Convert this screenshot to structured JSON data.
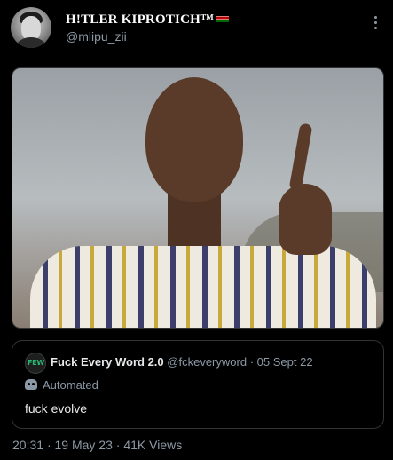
{
  "author": {
    "display_name": "H!TLER KIPROTICH™",
    "handle": "@mlipu_zii",
    "avatar_icon": "profile-photo",
    "flag_icon": "kenya-flag-icon"
  },
  "media": {
    "alt": "photo"
  },
  "quoted_post": {
    "avatar_text": "FEW",
    "account_name": "Fuck Every Word 2.0",
    "handle": "@fckeveryword",
    "date": "05 Sept 22",
    "label": "Automated",
    "text": "fuck evolve"
  },
  "meta": {
    "time": "20:31",
    "date": "19 May 23",
    "views": "41K Views"
  },
  "colors": {
    "background": "#000000",
    "text": "#e7e9ea",
    "muted": "#8b98a5",
    "border": "#2f3336"
  }
}
